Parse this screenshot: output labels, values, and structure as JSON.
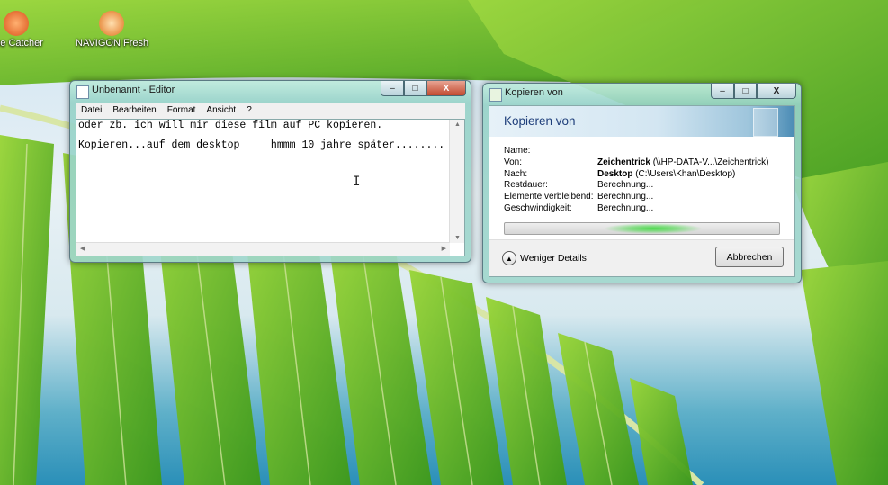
{
  "desktop": {
    "icons": [
      {
        "label": "ube Catcher",
        "icon": "tube-catcher-icon"
      },
      {
        "label": "NAVIGON Fresh",
        "icon": "navigon-fresh-icon"
      }
    ]
  },
  "notepad": {
    "title": "Unbenannt - Editor",
    "menu": [
      "Datei",
      "Bearbeiten",
      "Format",
      "Ansicht",
      "?"
    ],
    "lines": [
      "oder zb. ich will mir diese film auf PC kopieren.",
      "Kopieren...auf dem desktop     hmmm 10 jahre später........"
    ]
  },
  "copy_dialog": {
    "title": "Kopieren von",
    "heading": "Kopieren von",
    "fields": [
      {
        "key": "Name:",
        "bold": "",
        "value": ""
      },
      {
        "key": "Von:",
        "bold": "Zeichentrick",
        "value": " (\\\\HP-DATA-V...\\Zeichentrick)"
      },
      {
        "key": "Nach:",
        "bold": "Desktop",
        "value": " (C:\\Users\\Khan\\Desktop)"
      },
      {
        "key": "Restdauer:",
        "bold": "",
        "value": "Berechnung..."
      },
      {
        "key": "Elemente verbleibend:",
        "bold": "",
        "value": "Berechnung..."
      },
      {
        "key": "Geschwindigkeit:",
        "bold": "",
        "value": "Berechnung..."
      }
    ],
    "details_label": "Weniger Details",
    "cancel_label": "Abbrechen",
    "progress_state": "indeterminate"
  },
  "window_controls": {
    "min": "–",
    "max": "□",
    "close": "X"
  },
  "colors": {
    "accent_title": "#1e3e7a",
    "progress_glow": "#4ed84e",
    "close_button": "#c24a2f"
  }
}
